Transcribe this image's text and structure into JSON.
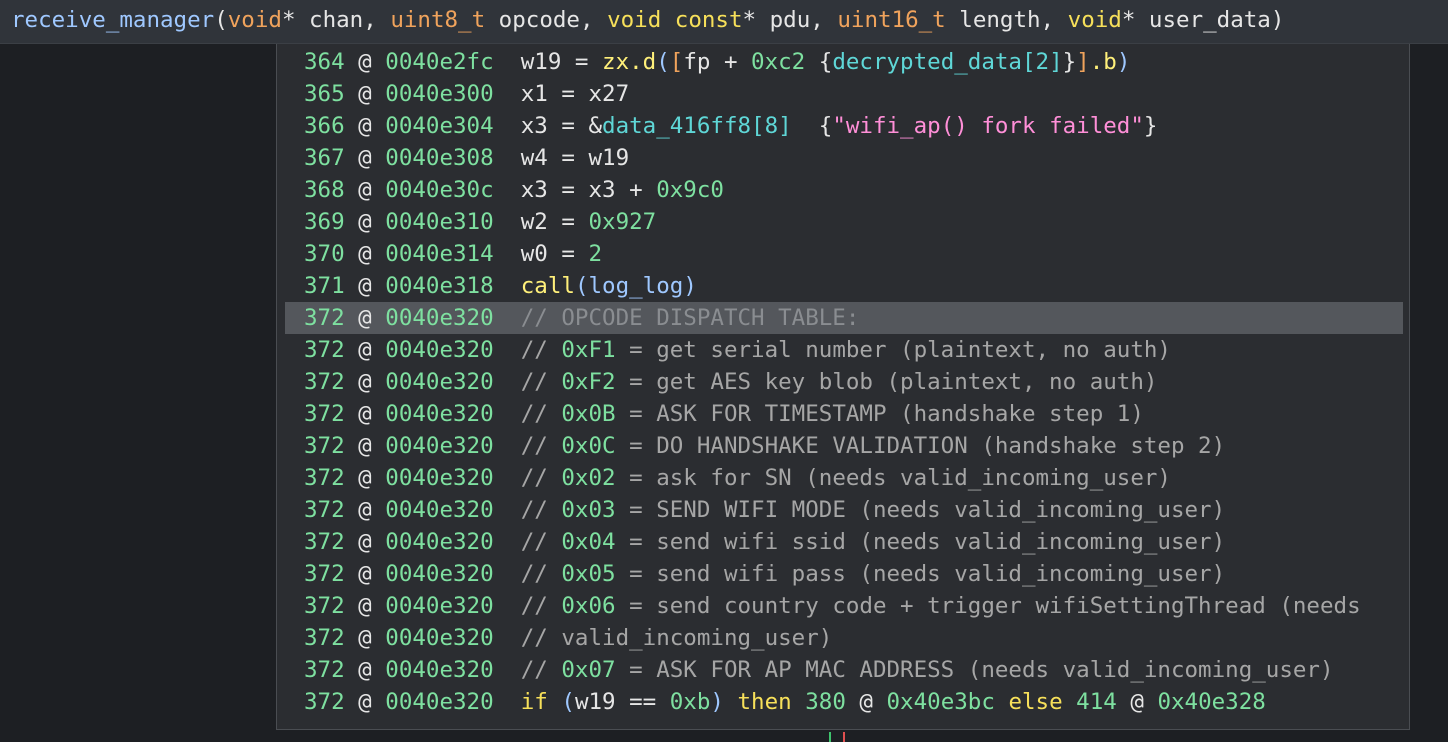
{
  "signature": {
    "func_name": "receive_manager",
    "open": "(",
    "p1_type": "void",
    "p1_rest": "* chan, ",
    "p2_type": "uint8_t",
    "p2_rest": " opcode, ",
    "p3_kw1": "void",
    "p3_sp": " ",
    "p3_kw2": "const",
    "p3_rest": "* pdu, ",
    "p4_type": "uint16_t",
    "p4_rest": " length, ",
    "p5_type": "void",
    "p5_rest": "* user_data",
    "close": ")"
  },
  "lines": [
    {
      "num": "364",
      "addr": "0040e2fc",
      "parts": [
        {
          "t": "w19 = ",
          "c": "c-ok"
        },
        {
          "t": "zx.d",
          "c": "c-fn"
        },
        {
          "t": "(",
          "c": "c-paren"
        },
        {
          "t": "[",
          "c": "c-bracket"
        },
        {
          "t": "fp + ",
          "c": "c-ok"
        },
        {
          "t": "0xc2",
          "c": "c-hex"
        },
        {
          "t": " {",
          "c": "c-ok"
        },
        {
          "t": "decrypted_data",
          "c": "c-data"
        },
        {
          "t": "[",
          "c": "c-data"
        },
        {
          "t": "2",
          "c": "c-data"
        },
        {
          "t": "]",
          "c": "c-data"
        },
        {
          "t": "}",
          "c": "c-ok"
        },
        {
          "t": "]",
          "c": "c-bracket"
        },
        {
          "t": ".b",
          "c": "c-fn"
        },
        {
          "t": ")",
          "c": "c-paren"
        }
      ]
    },
    {
      "num": "365",
      "addr": "0040e300",
      "parts": [
        {
          "t": "x1 = x27",
          "c": "c-ok"
        }
      ]
    },
    {
      "num": "366",
      "addr": "0040e304",
      "parts": [
        {
          "t": "x3 = &",
          "c": "c-ok"
        },
        {
          "t": "data_416ff8",
          "c": "c-data"
        },
        {
          "t": "[",
          "c": "c-data"
        },
        {
          "t": "8",
          "c": "c-data"
        },
        {
          "t": "]",
          "c": "c-data"
        },
        {
          "t": "  {",
          "c": "c-ok"
        },
        {
          "t": "\"wifi_ap() fork failed\"",
          "c": "c-str"
        },
        {
          "t": "}",
          "c": "c-ok"
        }
      ]
    },
    {
      "num": "367",
      "addr": "0040e308",
      "parts": [
        {
          "t": "w4 = w19",
          "c": "c-ok"
        }
      ]
    },
    {
      "num": "368",
      "addr": "0040e30c",
      "parts": [
        {
          "t": "x3 = x3 + ",
          "c": "c-ok"
        },
        {
          "t": "0x9c0",
          "c": "c-hex"
        }
      ]
    },
    {
      "num": "369",
      "addr": "0040e310",
      "parts": [
        {
          "t": "w2 = ",
          "c": "c-ok"
        },
        {
          "t": "0x927",
          "c": "c-hex"
        }
      ]
    },
    {
      "num": "370",
      "addr": "0040e314",
      "parts": [
        {
          "t": "w0 = ",
          "c": "c-ok"
        },
        {
          "t": "2",
          "c": "c-hex"
        }
      ]
    },
    {
      "num": "371",
      "addr": "0040e318",
      "parts": [
        {
          "t": "call",
          "c": "c-fn"
        },
        {
          "t": "(",
          "c": "c-paren"
        },
        {
          "t": "log_log",
          "c": "c-paren"
        },
        {
          "t": ")",
          "c": "c-paren"
        }
      ]
    },
    {
      "num": "372",
      "addr": "0040e320",
      "hl": true,
      "parts": [
        {
          "t": "// OPCODE DISPATCH TABLE:",
          "c": "c-cmt-hl"
        }
      ]
    },
    {
      "num": "372",
      "addr": "0040e320",
      "parts": [
        {
          "t": "// ",
          "c": "c-cmt"
        },
        {
          "t": "0xF1",
          "c": "c-hex"
        },
        {
          "t": " = get serial number (plaintext, no auth)",
          "c": "c-cmt"
        }
      ]
    },
    {
      "num": "372",
      "addr": "0040e320",
      "parts": [
        {
          "t": "// ",
          "c": "c-cmt"
        },
        {
          "t": "0xF2",
          "c": "c-hex"
        },
        {
          "t": " = get AES key blob (plaintext, no auth)",
          "c": "c-cmt"
        }
      ]
    },
    {
      "num": "372",
      "addr": "0040e320",
      "parts": [
        {
          "t": "// ",
          "c": "c-cmt"
        },
        {
          "t": "0x0B",
          "c": "c-hex"
        },
        {
          "t": " = ASK FOR TIMESTAMP (handshake step 1)",
          "c": "c-cmt"
        }
      ]
    },
    {
      "num": "372",
      "addr": "0040e320",
      "parts": [
        {
          "t": "// ",
          "c": "c-cmt"
        },
        {
          "t": "0x0C",
          "c": "c-hex"
        },
        {
          "t": " = DO HANDSHAKE VALIDATION (handshake step 2)",
          "c": "c-cmt"
        }
      ]
    },
    {
      "num": "372",
      "addr": "0040e320",
      "parts": [
        {
          "t": "// ",
          "c": "c-cmt"
        },
        {
          "t": "0x02",
          "c": "c-hex"
        },
        {
          "t": " = ask for SN (needs valid_incoming_user)",
          "c": "c-cmt"
        }
      ]
    },
    {
      "num": "372",
      "addr": "0040e320",
      "parts": [
        {
          "t": "// ",
          "c": "c-cmt"
        },
        {
          "t": "0x03",
          "c": "c-hex"
        },
        {
          "t": " = SEND WIFI MODE (needs valid_incoming_user)",
          "c": "c-cmt"
        }
      ]
    },
    {
      "num": "372",
      "addr": "0040e320",
      "parts": [
        {
          "t": "// ",
          "c": "c-cmt"
        },
        {
          "t": "0x04",
          "c": "c-hex"
        },
        {
          "t": " = send wifi ssid (needs valid_incoming_user)",
          "c": "c-cmt"
        }
      ]
    },
    {
      "num": "372",
      "addr": "0040e320",
      "parts": [
        {
          "t": "// ",
          "c": "c-cmt"
        },
        {
          "t": "0x05",
          "c": "c-hex"
        },
        {
          "t": " = send wifi pass (needs valid_incoming_user)",
          "c": "c-cmt"
        }
      ]
    },
    {
      "num": "372",
      "addr": "0040e320",
      "parts": [
        {
          "t": "// ",
          "c": "c-cmt"
        },
        {
          "t": "0x06",
          "c": "c-hex"
        },
        {
          "t": " = send country code + trigger wifiSettingThread (needs",
          "c": "c-cmt"
        }
      ]
    },
    {
      "num": "372",
      "addr": "0040e320",
      "parts": [
        {
          "t": "// valid_incoming_user)",
          "c": "c-cmt"
        }
      ]
    },
    {
      "num": "372",
      "addr": "0040e320",
      "parts": [
        {
          "t": "// ",
          "c": "c-cmt"
        },
        {
          "t": "0x07",
          "c": "c-hex"
        },
        {
          "t": " = ASK FOR AP MAC ADDRESS (needs valid_incoming_user)",
          "c": "c-cmt"
        }
      ]
    },
    {
      "num": "372",
      "addr": "0040e320",
      "parts": [
        {
          "t": "if",
          "c": "c-kw"
        },
        {
          "t": " ",
          "c": "c-ok"
        },
        {
          "t": "(",
          "c": "c-paren"
        },
        {
          "t": "w19 == ",
          "c": "c-ok"
        },
        {
          "t": "0xb",
          "c": "c-hex"
        },
        {
          "t": ")",
          "c": "c-paren"
        },
        {
          "t": " ",
          "c": "c-ok"
        },
        {
          "t": "then",
          "c": "c-kw"
        },
        {
          "t": " ",
          "c": "c-ok"
        },
        {
          "t": "380",
          "c": "c-hex"
        },
        {
          "t": " @ ",
          "c": "c-ok"
        },
        {
          "t": "0x40e3bc",
          "c": "c-hex"
        },
        {
          "t": " ",
          "c": "c-ok"
        },
        {
          "t": "else",
          "c": "c-kw"
        },
        {
          "t": " ",
          "c": "c-ok"
        },
        {
          "t": "414",
          "c": "c-hex"
        },
        {
          "t": " @ ",
          "c": "c-ok"
        },
        {
          "t": "0x40e328",
          "c": "c-hex"
        }
      ]
    }
  ]
}
